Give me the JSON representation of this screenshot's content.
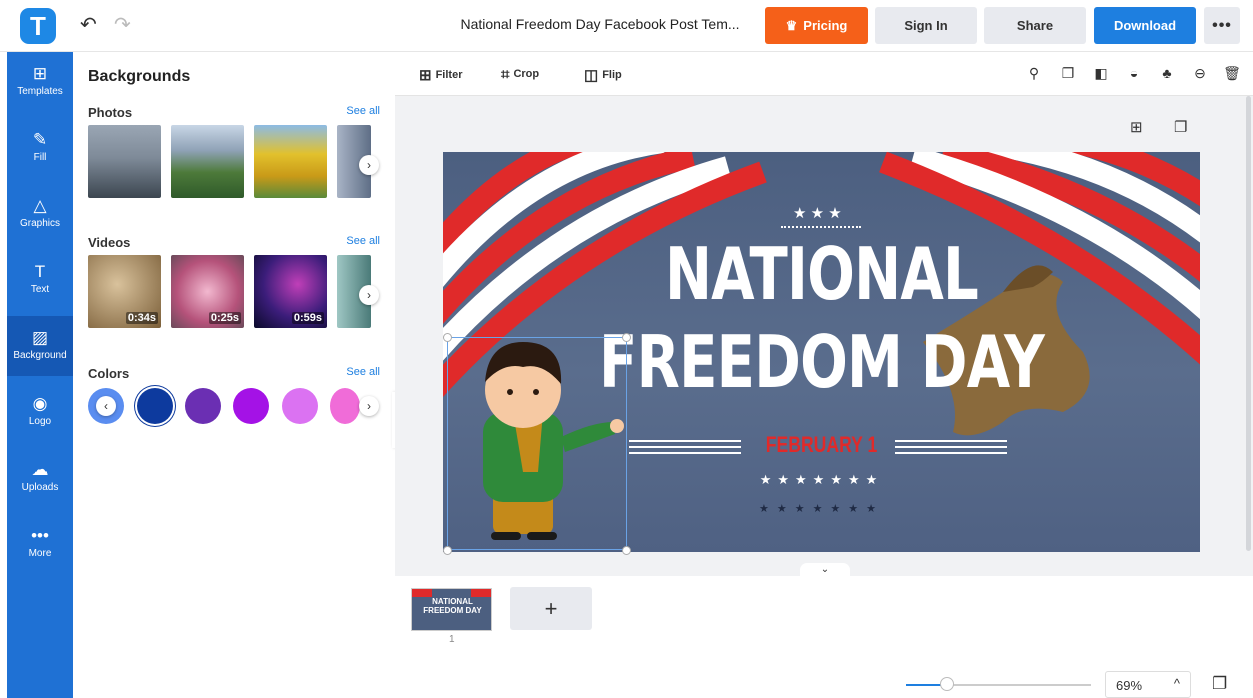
{
  "app": {
    "logo_letter": "T",
    "doc_title": "National Freedom Day Facebook Post Tem...",
    "undo_icon": "↶",
    "redo_icon": "↷"
  },
  "header": {
    "pricing": "Pricing",
    "signin": "Sign In",
    "share": "Share",
    "download": "Download",
    "more": "•••",
    "accent": "#f56019",
    "primary": "#1e7fe0"
  },
  "nav": {
    "items": [
      {
        "label": "Templates",
        "icon": "⊞"
      },
      {
        "label": "Fill",
        "icon": "✎"
      },
      {
        "label": "Graphics",
        "icon": "△"
      },
      {
        "label": "Text",
        "icon": "T"
      },
      {
        "label": "Background",
        "icon": "▨"
      },
      {
        "label": "Logo",
        "icon": "◉"
      },
      {
        "label": "Uploads",
        "icon": "☁"
      },
      {
        "label": "More",
        "icon": "•••"
      }
    ],
    "active": "Background",
    "color": "#1f71d4"
  },
  "panel": {
    "title": "Backgrounds",
    "photos": {
      "title": "Photos",
      "see_all": "See all"
    },
    "videos": {
      "title": "Videos",
      "see_all": "See all",
      "durations": [
        "0:34s",
        "0:25s",
        "0:59s"
      ]
    },
    "colors": {
      "title": "Colors",
      "see_all": "See all",
      "swatches": [
        "#0d3a9e",
        "#6b2fb3",
        "#a412e6",
        "#db72f2",
        "#f06cd8"
      ]
    }
  },
  "toolbar": {
    "filter": "Filter",
    "crop": "Crop",
    "flip": "Flip"
  },
  "design": {
    "headline_line1": "NATIONAL",
    "headline_line2": "FREEDOM DAY",
    "date": "FEBRUARY 1",
    "stars_top": "★ ★ ★",
    "stars_row1": "★★★★★★★",
    "stars_row2": "★★★★★★★"
  },
  "pages": {
    "thumb_line1": "NATIONAL",
    "thumb_line2": "FREEDOM DAY",
    "page_number": "1",
    "add_label": "+"
  },
  "zoom": {
    "value": "69%",
    "caret": "^",
    "level_fraction": 0.22
  }
}
